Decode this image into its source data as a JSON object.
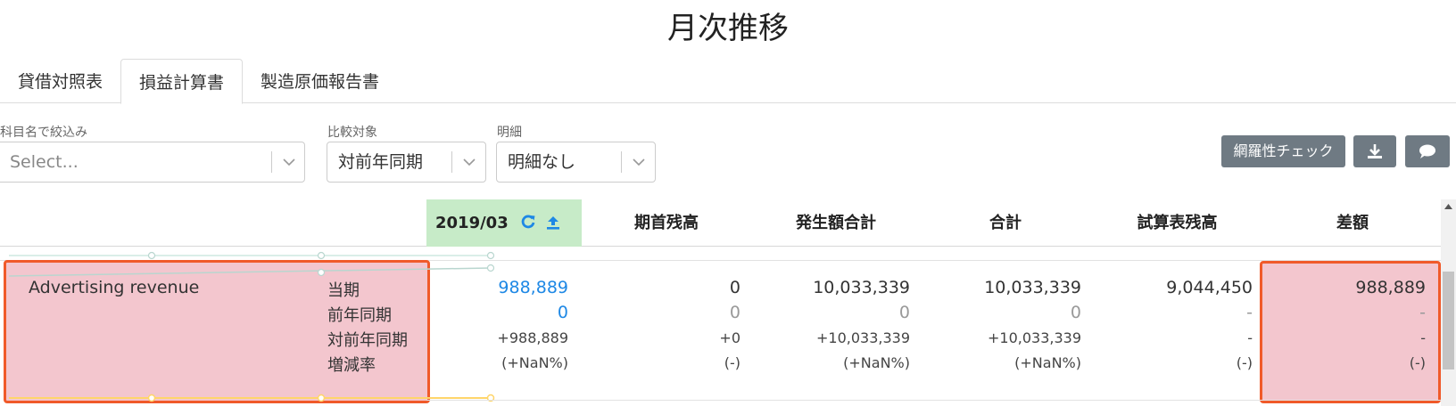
{
  "page": {
    "title": "月次推移"
  },
  "tabs": [
    {
      "label": "貸借対照表",
      "active": false
    },
    {
      "label": "損益計算書",
      "active": true
    },
    {
      "label": "製造原価報告書",
      "active": false
    }
  ],
  "filters": {
    "account": {
      "label": "科目名で絞込み",
      "placeholder": "Select..."
    },
    "compare": {
      "label": "比較対象",
      "value": "対前年同期"
    },
    "detail": {
      "label": "明細",
      "value": "明細なし"
    }
  },
  "toolbar": {
    "check_label": "網羅性チェック",
    "download_icon": "download-icon",
    "comment_icon": "comment-icon",
    "button_color": "#6f7a83"
  },
  "table": {
    "headers": {
      "period": "2019/03",
      "opening": "期首残高",
      "movement": "発生額合計",
      "total": "合計",
      "trial": "試算表残高",
      "diff": "差額"
    },
    "header_period_bg": "#c7ebc8",
    "row": {
      "account": "Advertising revenue",
      "labels": [
        "当期",
        "前年同期",
        "対前年同期",
        "増減率"
      ],
      "period": [
        "988,889",
        "0",
        "+988,889",
        "(+NaN%)"
      ],
      "opening": [
        "0",
        "0",
        "+0",
        "(-)"
      ],
      "movement": [
        "10,033,339",
        "0",
        "+10,033,339",
        "(+NaN%)"
      ],
      "total": [
        "10,033,339",
        "0",
        "+10,033,339",
        "(+NaN%)"
      ],
      "trial": [
        "9,044,450",
        "-",
        "-",
        "(-)"
      ],
      "diff": [
        "988,889",
        "-",
        "-",
        "(-)"
      ]
    },
    "highlight_fill": "#f3c6ce",
    "highlight_border": "#f05a2a",
    "link_color": "#1e88e5"
  }
}
